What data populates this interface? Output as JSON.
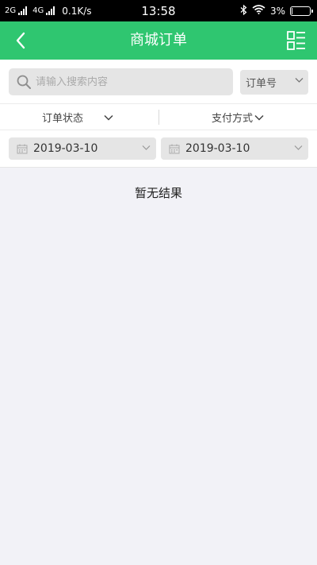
{
  "status_bar": {
    "network_1": "2G",
    "network_2": "4G",
    "speed": "0.1K/s",
    "time": "13:58",
    "battery": "3%",
    "battery_level": 0.03,
    "icons": [
      "bluetooth-icon",
      "wifi-icon",
      "battery-icon"
    ]
  },
  "header": {
    "title": "商城订单",
    "back_icon": "back-arrow-icon",
    "menu_icon": "list-grid-icon",
    "color": "#2fc670"
  },
  "search": {
    "placeholder": "请输入搜索内容",
    "value": "",
    "type_selected": "订单号"
  },
  "filters": {
    "order_status_label": "订单状态",
    "payment_method_label": "支付方式"
  },
  "dates": {
    "start": "2019-03-10",
    "end": "2019-03-10"
  },
  "results": {
    "empty_text": "暂无结果"
  }
}
